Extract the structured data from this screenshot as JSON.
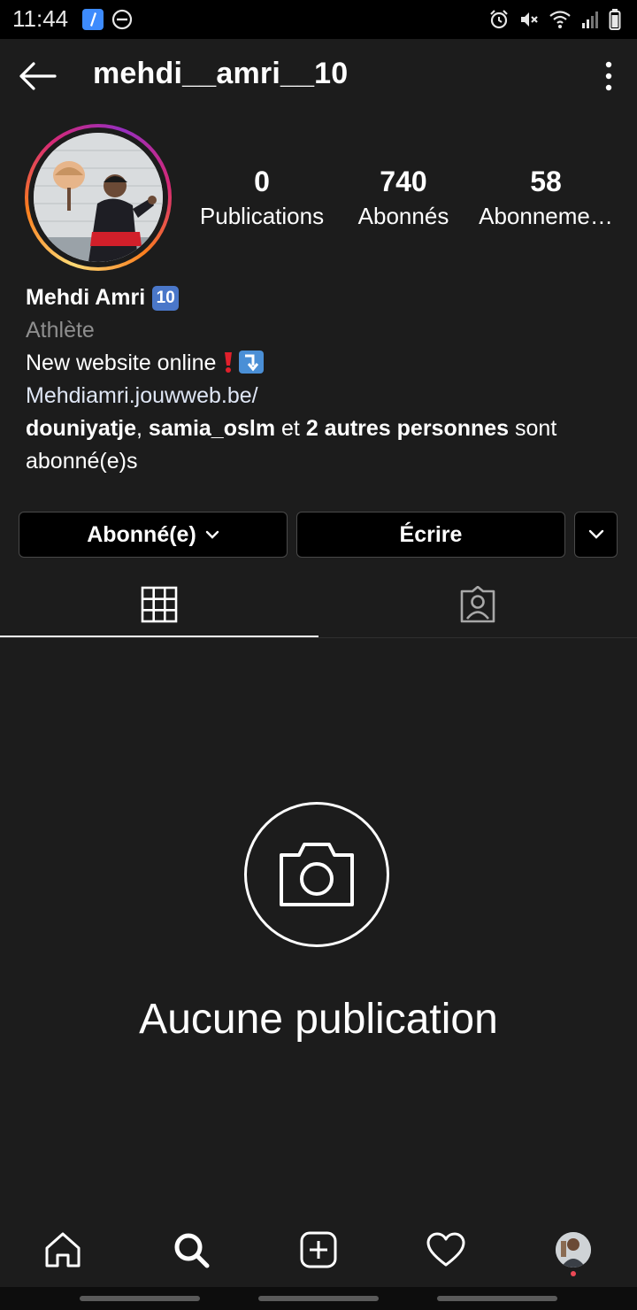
{
  "status_bar": {
    "time": "11:44",
    "left_icons": [
      "app-notification-icon",
      "do-not-disturb-icon"
    ],
    "right_icons": [
      "alarm-icon",
      "mute-icon",
      "wifi-icon",
      "signal-icon",
      "battery-icon"
    ]
  },
  "header": {
    "username": "mehdi__amri__10",
    "back_icon": "arrow-left-icon",
    "more_icon": "more-vertical-icon"
  },
  "profile": {
    "stats": [
      {
        "value": "0",
        "label": "Publications"
      },
      {
        "value": "740",
        "label": "Abonnés"
      },
      {
        "value": "58",
        "label": "Abonneme…"
      }
    ],
    "name": "Mehdi Amri",
    "name_badge": "10",
    "category": "Athlète",
    "bio_text": "New website online",
    "website": "Mehdiamri.jouwweb.be/",
    "followed_by": {
      "user1": "douniyatje",
      "sep": ", ",
      "user2": "samia_oslm",
      "and": " et ",
      "others": "2 autres personnes",
      "suffix": " sont abonné(e)s"
    }
  },
  "actions": {
    "follow_label": "Abonné(e)",
    "message_label": "Écrire"
  },
  "tabs": [
    {
      "name": "grid",
      "icon": "grid-icon",
      "active": true
    },
    {
      "name": "tagged",
      "icon": "tagged-person-icon",
      "active": false
    }
  ],
  "empty_state": {
    "icon": "camera-icon",
    "text": "Aucune publication"
  },
  "bottom_nav": [
    "home-icon",
    "search-icon",
    "add-post-icon",
    "heart-icon",
    "profile-avatar"
  ],
  "colors": {
    "background": "#1c1c1c",
    "text": "#ffffff",
    "secondary_text": "#8e8e8e",
    "link": "#dfe6f5",
    "notification_dot": "#ed4956"
  }
}
